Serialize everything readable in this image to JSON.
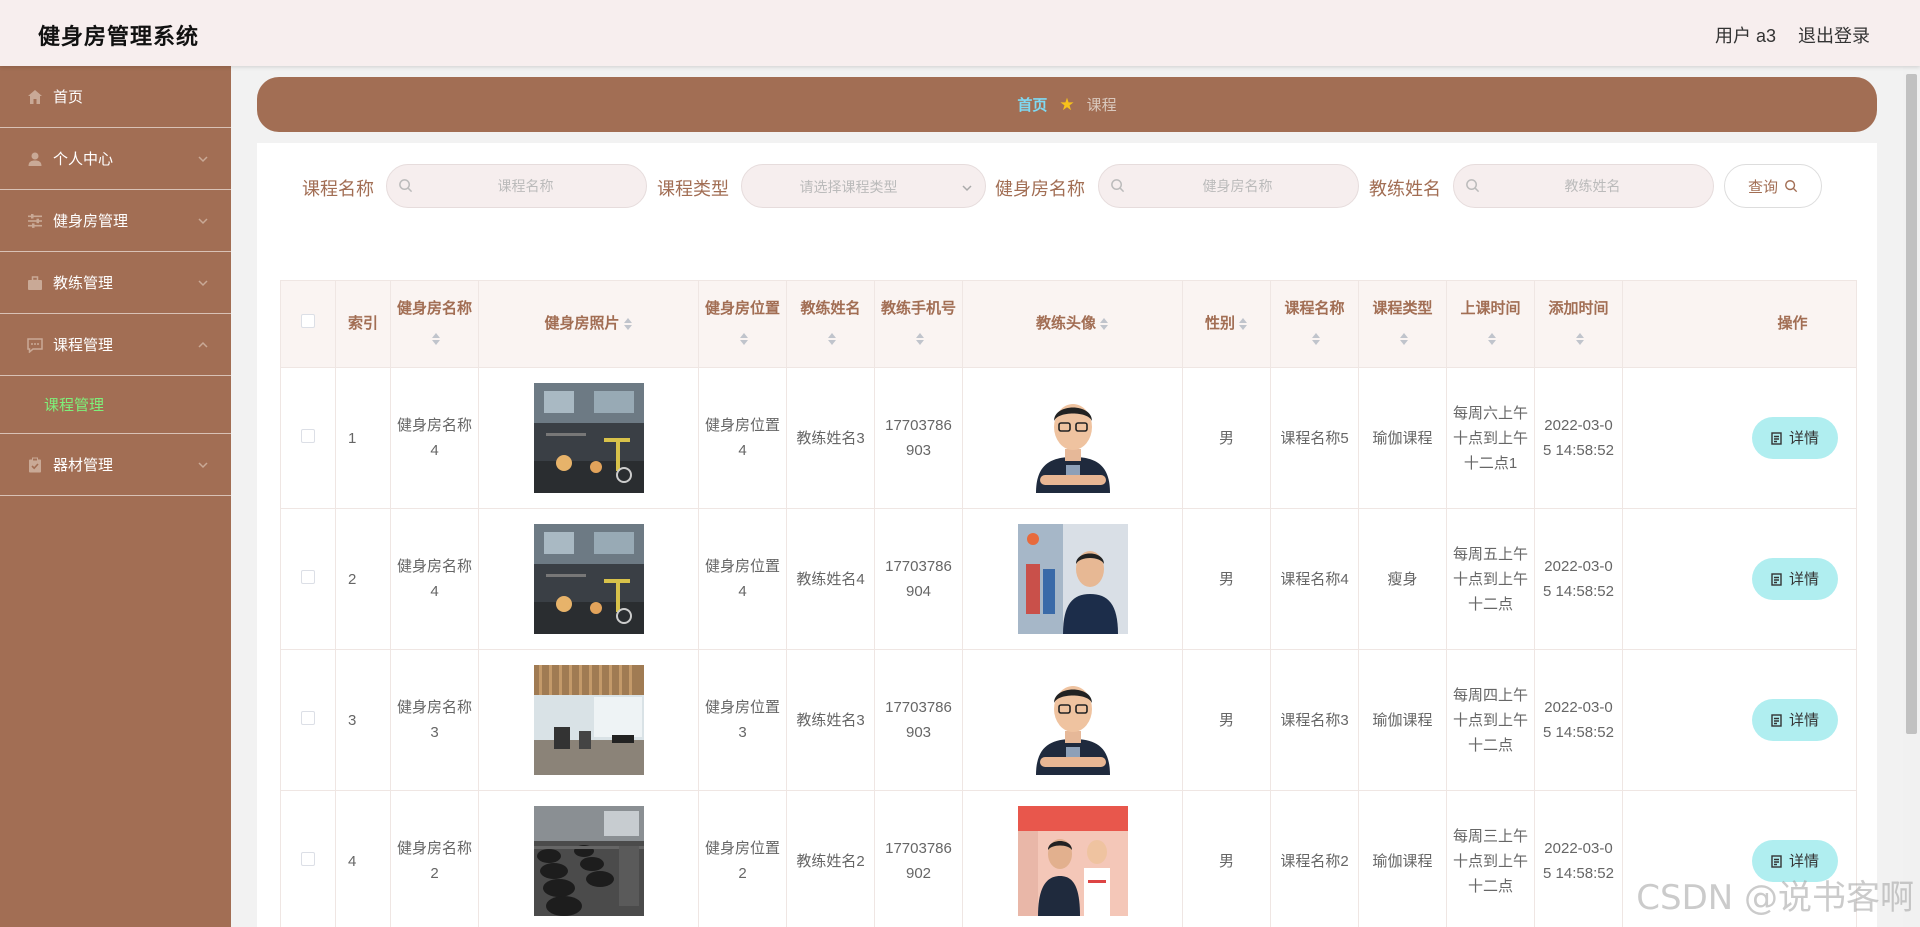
{
  "app": {
    "title": "健身房管理系统",
    "user": "用户 a3",
    "logout": "退出登录"
  },
  "sidebar": {
    "items": [
      {
        "label": "首页",
        "icon": "home-icon"
      },
      {
        "label": "个人中心",
        "icon": "user-icon"
      },
      {
        "label": "健身房管理",
        "icon": "sliders-icon"
      },
      {
        "label": "教练管理",
        "icon": "briefcase-icon"
      },
      {
        "label": "课程管理",
        "icon": "chat-icon"
      },
      {
        "label": "器材管理",
        "icon": "clipboard-icon"
      }
    ],
    "active_sub": "课程管理"
  },
  "breadcrumb": {
    "home": "首页",
    "current": "课程"
  },
  "search": {
    "course_name_label": "课程名称",
    "course_name_placeholder": "课程名称",
    "course_type_label": "课程类型",
    "course_type_placeholder": "请选择课程类型",
    "gym_name_label": "健身房名称",
    "gym_name_placeholder": "健身房名称",
    "coach_name_label": "教练姓名",
    "coach_name_placeholder": "教练姓名",
    "query_button": "查询"
  },
  "table": {
    "headers": {
      "index": "索引",
      "gym_name": "健身房名称",
      "gym_photo": "健身房照片",
      "gym_location": "健身房位置",
      "coach_name": "教练姓名",
      "coach_phone": "教练手机号",
      "coach_avatar": "教练头像",
      "gender": "性别",
      "course_name": "课程名称",
      "course_type": "课程类型",
      "class_time": "上课时间",
      "added_time": "添加时间",
      "action": "操作"
    },
    "detail_label": "详情",
    "rows": [
      {
        "index": "1",
        "gym_name": "健身房名称4",
        "gym_location": "健身房位置4",
        "coach_name": "教练姓名3",
        "coach_phone": "17703786903",
        "gender": "男",
        "course_name": "课程名称5",
        "course_type": "瑜伽课程",
        "class_time": "每周六上午十点到上午十二点1",
        "added_time": "2022-03-05 14:58:52"
      },
      {
        "index": "2",
        "gym_name": "健身房名称4",
        "gym_location": "健身房位置4",
        "coach_name": "教练姓名4",
        "coach_phone": "17703786904",
        "gender": "男",
        "course_name": "课程名称4",
        "course_type": "瘦身",
        "class_time": "每周五上午十点到上午十二点",
        "added_time": "2022-03-05 14:58:52"
      },
      {
        "index": "3",
        "gym_name": "健身房名称3",
        "gym_location": "健身房位置3",
        "coach_name": "教练姓名3",
        "coach_phone": "17703786903",
        "gender": "男",
        "course_name": "课程名称3",
        "course_type": "瑜伽课程",
        "class_time": "每周四上午十点到上午十二点",
        "added_time": "2022-03-05 14:58:52"
      },
      {
        "index": "4",
        "gym_name": "健身房名称2",
        "gym_location": "健身房位置2",
        "coach_name": "教练姓名2",
        "coach_phone": "17703786902",
        "gender": "男",
        "course_name": "课程名称2",
        "course_type": "瑜伽课程",
        "class_time": "每周三上午十点到上午十二点",
        "added_time": "2022-03-05 14:58:52"
      }
    ]
  },
  "watermark": "CSDN @说书客啊",
  "colors": {
    "brand": "#a26e54",
    "header_bg": "#f7eeee",
    "active_sub": "#7ef07a",
    "detail_btn": "#b0eef0"
  }
}
